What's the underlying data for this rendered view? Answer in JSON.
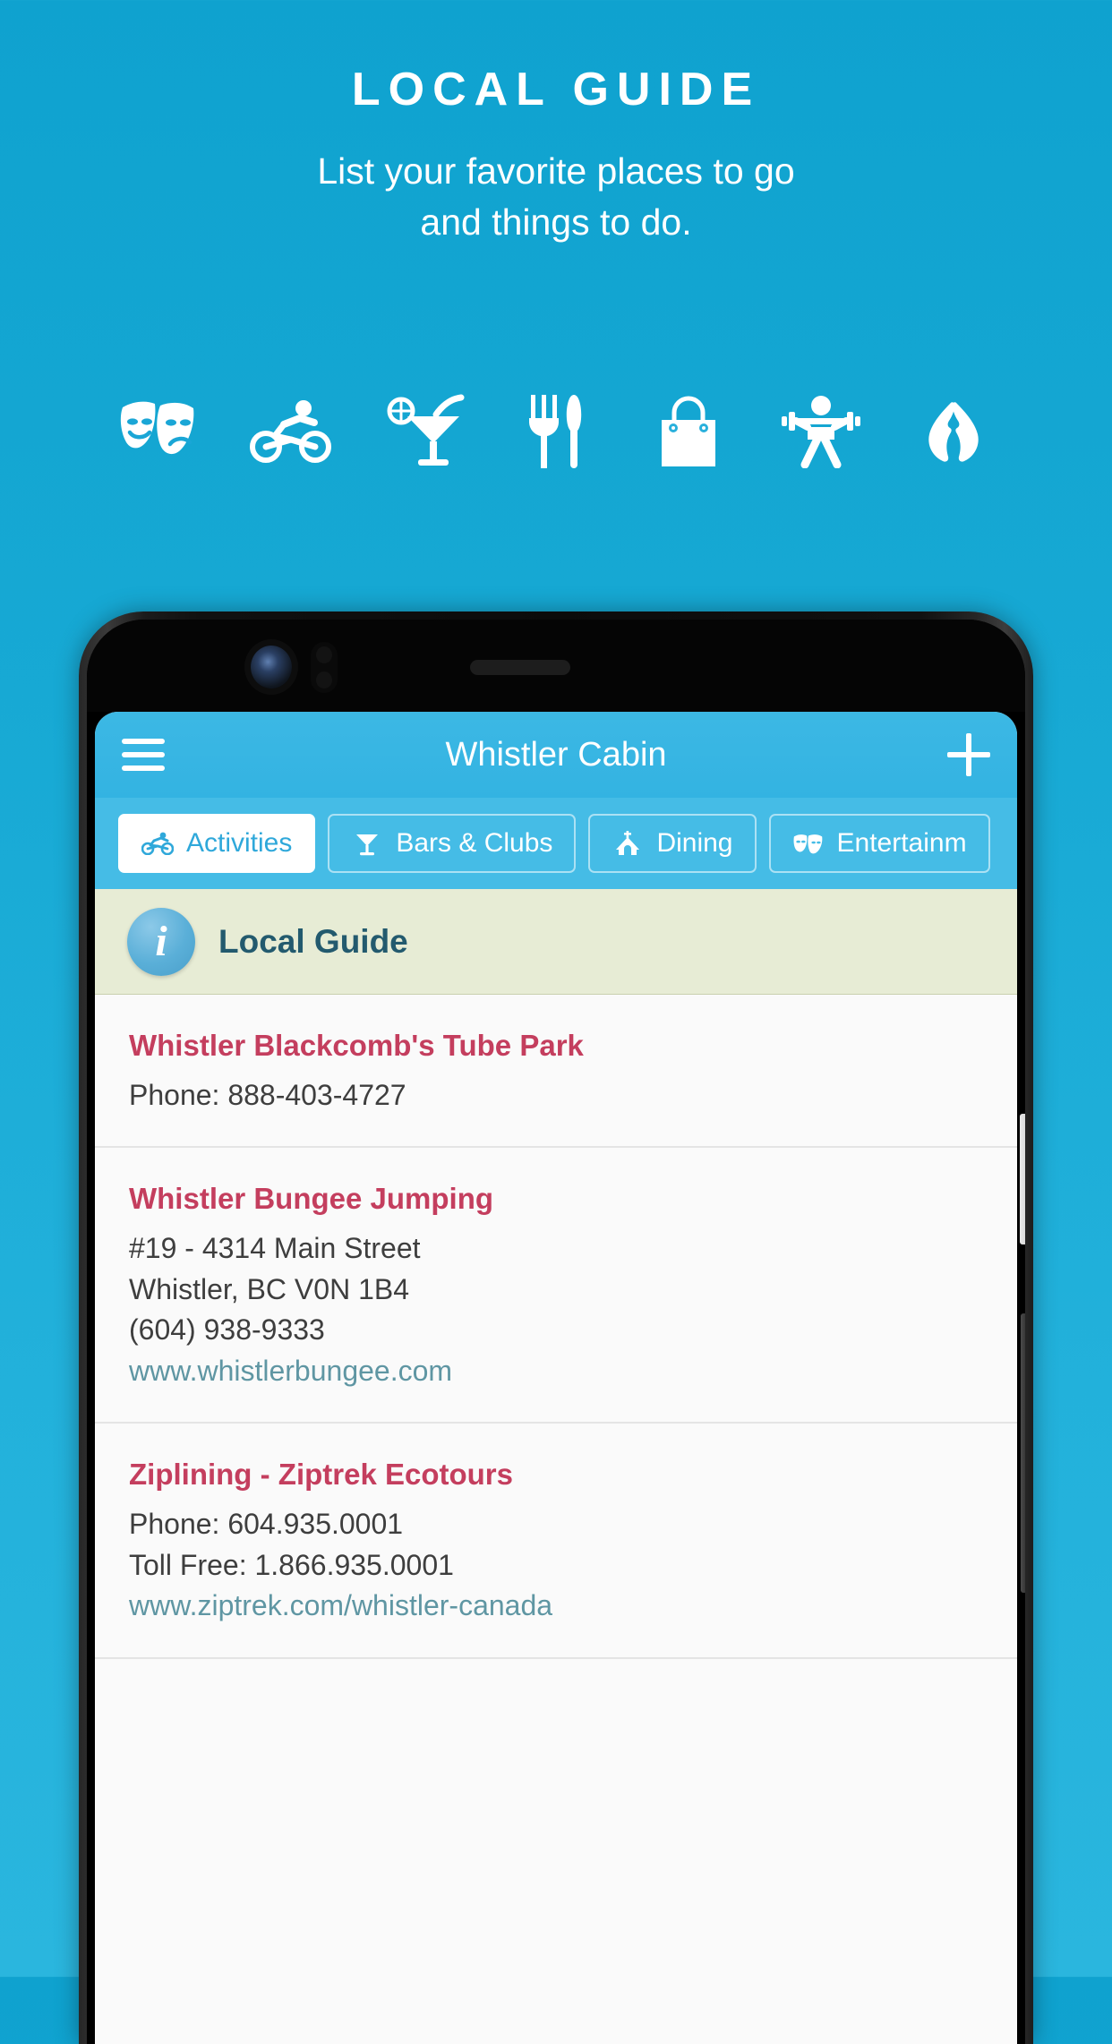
{
  "promo": {
    "title": "LOCAL GUIDE",
    "subtitle_line1": "List your favorite places to go",
    "subtitle_line2": "and things to do.",
    "accent_color": "#17a9d4",
    "icons": [
      {
        "name": "theater-masks-icon"
      },
      {
        "name": "cyclist-icon"
      },
      {
        "name": "cocktail-icon"
      },
      {
        "name": "fork-knife-icon"
      },
      {
        "name": "shopping-bag-icon"
      },
      {
        "name": "weightlifter-icon"
      },
      {
        "name": "spa-hands-icon"
      }
    ]
  },
  "app": {
    "header": {
      "menu_icon": "hamburger-icon",
      "title": "Whistler Cabin",
      "add_icon": "plus-icon"
    },
    "tabs": [
      {
        "label": "Activities",
        "icon": "bicycle-icon",
        "active": true
      },
      {
        "label": "Bars & Clubs",
        "icon": "martini-glass-icon",
        "active": false
      },
      {
        "label": "Dining",
        "icon": "chapel-icon",
        "active": false
      },
      {
        "label": "Entertainm",
        "icon": "theater-masks-icon",
        "active": false
      }
    ],
    "banner": {
      "icon": "info-icon",
      "icon_glyph": "i",
      "label": "Local Guide",
      "background_color": "#e7ecd5",
      "text_color": "#235a6e"
    },
    "list": [
      {
        "title": "Whistler Blackcomb's Tube Park",
        "lines": [
          "Phone: 888-403-4727"
        ],
        "link": ""
      },
      {
        "title": "Whistler Bungee Jumping",
        "lines": [
          "#19 - 4314 Main Street",
          "Whistler, BC V0N 1B4",
          "(604) 938-9333"
        ],
        "link": "www.whistlerbungee.com"
      },
      {
        "title": "Ziplining - Ziptrek Ecotours",
        "lines": [
          "Phone: 604.935.0001",
          "Toll Free: 1.866.935.0001"
        ],
        "link": "www.ziptrek.com/whistler-canada"
      }
    ],
    "colors": {
      "title_color": "#c43e5e",
      "link_color": "#5f96a3",
      "appbar_color": "#33b3e2",
      "tabbar_color": "#45bce6"
    }
  },
  "device": {
    "camera": "front-camera",
    "sensor": "proximity-sensor",
    "speaker": "earpiece-speaker",
    "power_button": "power-button",
    "volume_button": "volume-rocker"
  }
}
